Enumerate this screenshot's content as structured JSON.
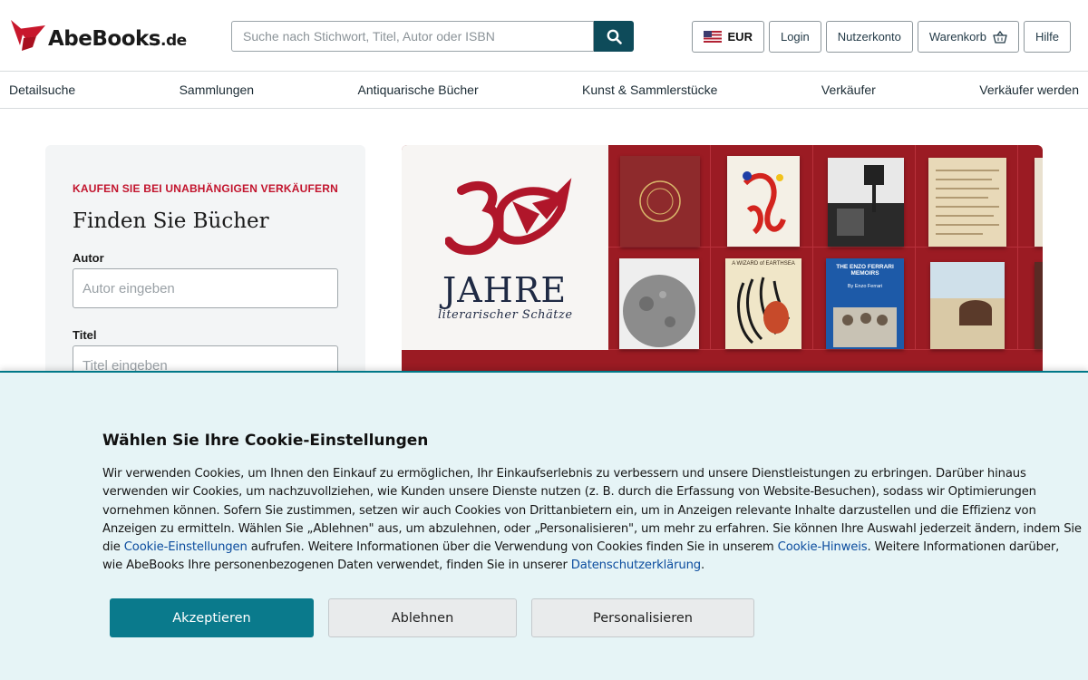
{
  "header": {
    "brand": "AbeBooks",
    "tld": ".de",
    "search_placeholder": "Suche nach Stichwort, Titel, Autor oder ISBN",
    "currency": "EUR",
    "login": "Login",
    "account": "Nutzerkonto",
    "cart": "Warenkorb",
    "help": "Hilfe"
  },
  "nav": {
    "items": [
      "Detailsuche",
      "Sammlungen",
      "Antiquarische Bücher",
      "Kunst & Sammlerstücke",
      "Verkäufer",
      "Verkäufer werden"
    ]
  },
  "finder": {
    "eyebrow": "KAUFEN SIE BEI UNABHÄNGIGEN VERKÄUFERN",
    "title": "Finden Sie Bücher",
    "author_label": "Autor",
    "author_placeholder": "Autor eingeben",
    "title_label": "Titel",
    "title_placeholder": "Titel eingeben"
  },
  "banner": {
    "headline": "JAHRE",
    "subline": "literarischer Schätze",
    "book_titles": [
      "A WIZARD of EARTHSEA",
      "THE ENZO FERRARI MEMOIRS",
      "By Enzo Ferrari"
    ]
  },
  "cookie": {
    "title": "Wählen Sie Ihre Cookie-Einstellungen",
    "text_1": "Wir verwenden Cookies, um Ihnen den Einkauf zu ermöglichen, Ihr Einkaufserlebnis zu verbessern und unsere Dienstleistungen zu erbringen. Darüber hinaus verwenden wir Cookies, um nachzuvollziehen, wie Kunden unsere Dienste nutzen (z. B. durch die Erfassung von Website-Besuchen), sodass wir Optimierungen vornehmen können. Sofern Sie zustimmen, setzen wir auch Cookies von Drittanbietern ein, um in Anzeigen relevante Inhalte darzustellen und die Effizienz von Anzeigen zu ermitteln. Wählen Sie „Ablehnen\" aus, um abzulehnen, oder „Personalisieren\", um mehr zu erfahren. Sie können Ihre Auswahl jederzeit ändern, indem Sie die ",
    "link_settings": "Cookie-Einstellungen",
    "text_2": " aufrufen. Weitere Informationen über die Verwendung von Cookies finden Sie in unserem ",
    "link_notice": "Cookie-Hinweis",
    "text_3": ". Weitere Informationen darüber, wie AbeBooks Ihre personenbezogenen Daten verwendet, finden Sie in unserer ",
    "link_privacy": "Datenschutzerklärung",
    "text_4": ".",
    "accept": "Akzeptieren",
    "decline": "Ablehnen",
    "customize": "Personalisieren"
  },
  "colors": {
    "brand_red": "#c2142d",
    "search_button": "#0e4b5a",
    "accept_button": "#0a7a8c",
    "banner_red": "#9b1b23"
  }
}
